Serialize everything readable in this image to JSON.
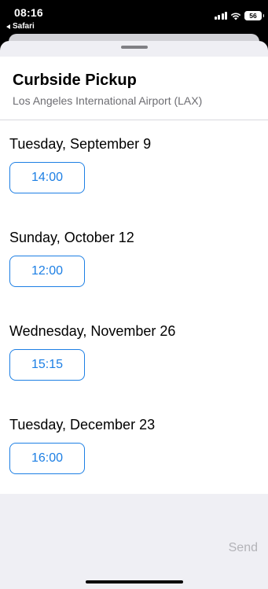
{
  "status_bar": {
    "time": "08:16",
    "back_app": "Safari",
    "battery": "56"
  },
  "sheet": {
    "title": "Curbside Pickup",
    "subtitle": "Los Angeles International Airport (LAX)"
  },
  "days": [
    {
      "label": "Tuesday, September 9",
      "slot": "14:00"
    },
    {
      "label": "Sunday, October 12",
      "slot": "12:00"
    },
    {
      "label": "Wednesday, November 26",
      "slot": "15:15"
    },
    {
      "label": "Tuesday, December 23",
      "slot": "16:00"
    }
  ],
  "footer": {
    "send_label": "Send"
  },
  "colors": {
    "accent": "#1d7fe4",
    "disabled": "#b3b3b8"
  }
}
